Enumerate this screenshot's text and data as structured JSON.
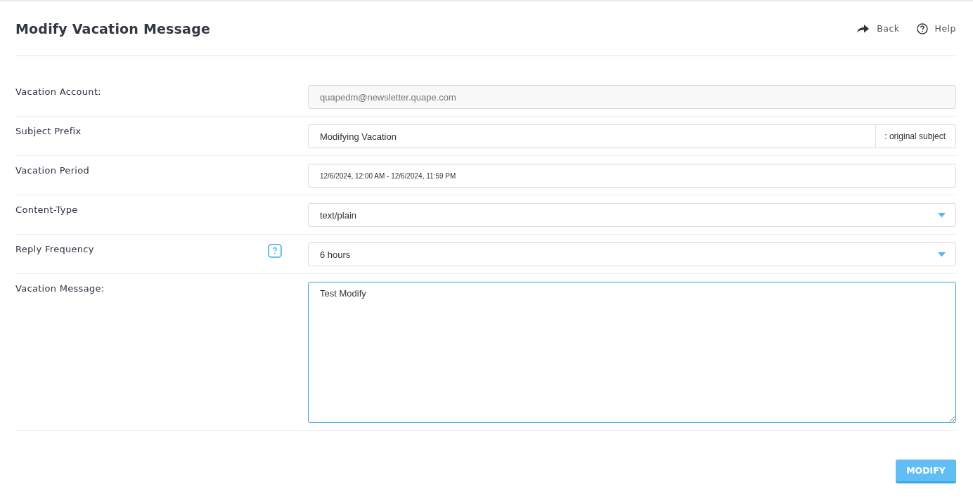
{
  "header": {
    "title": "Modify Vacation Message",
    "links": [
      {
        "kind": "back",
        "label": "Back"
      },
      {
        "kind": "help",
        "label": "Help"
      }
    ]
  },
  "fields": [
    {
      "kind": "readonly",
      "label": "Vacation Account:",
      "value": "quapedm@newsletter.quape.com",
      "has_help": false
    },
    {
      "kind": "suffixed",
      "label": "Subject Prefix",
      "value": "Modifying Vacation",
      "suffix": ": original subject",
      "has_help": false
    },
    {
      "kind": "period",
      "label": "Vacation Period",
      "value": "12/6/2024, 12:00 AM - 12/6/2024, 11:59 PM",
      "has_help": false
    },
    {
      "kind": "select",
      "label": "Content-Type",
      "value": "text/plain",
      "has_help": false
    },
    {
      "kind": "select",
      "label": "Reply Frequency",
      "value": "6 hours",
      "has_help": true
    },
    {
      "kind": "textarea",
      "label": "Vacation Message:",
      "value": "Test Modify",
      "focused": true,
      "has_help": false
    }
  ],
  "submit": {
    "label": "MODIFY"
  }
}
